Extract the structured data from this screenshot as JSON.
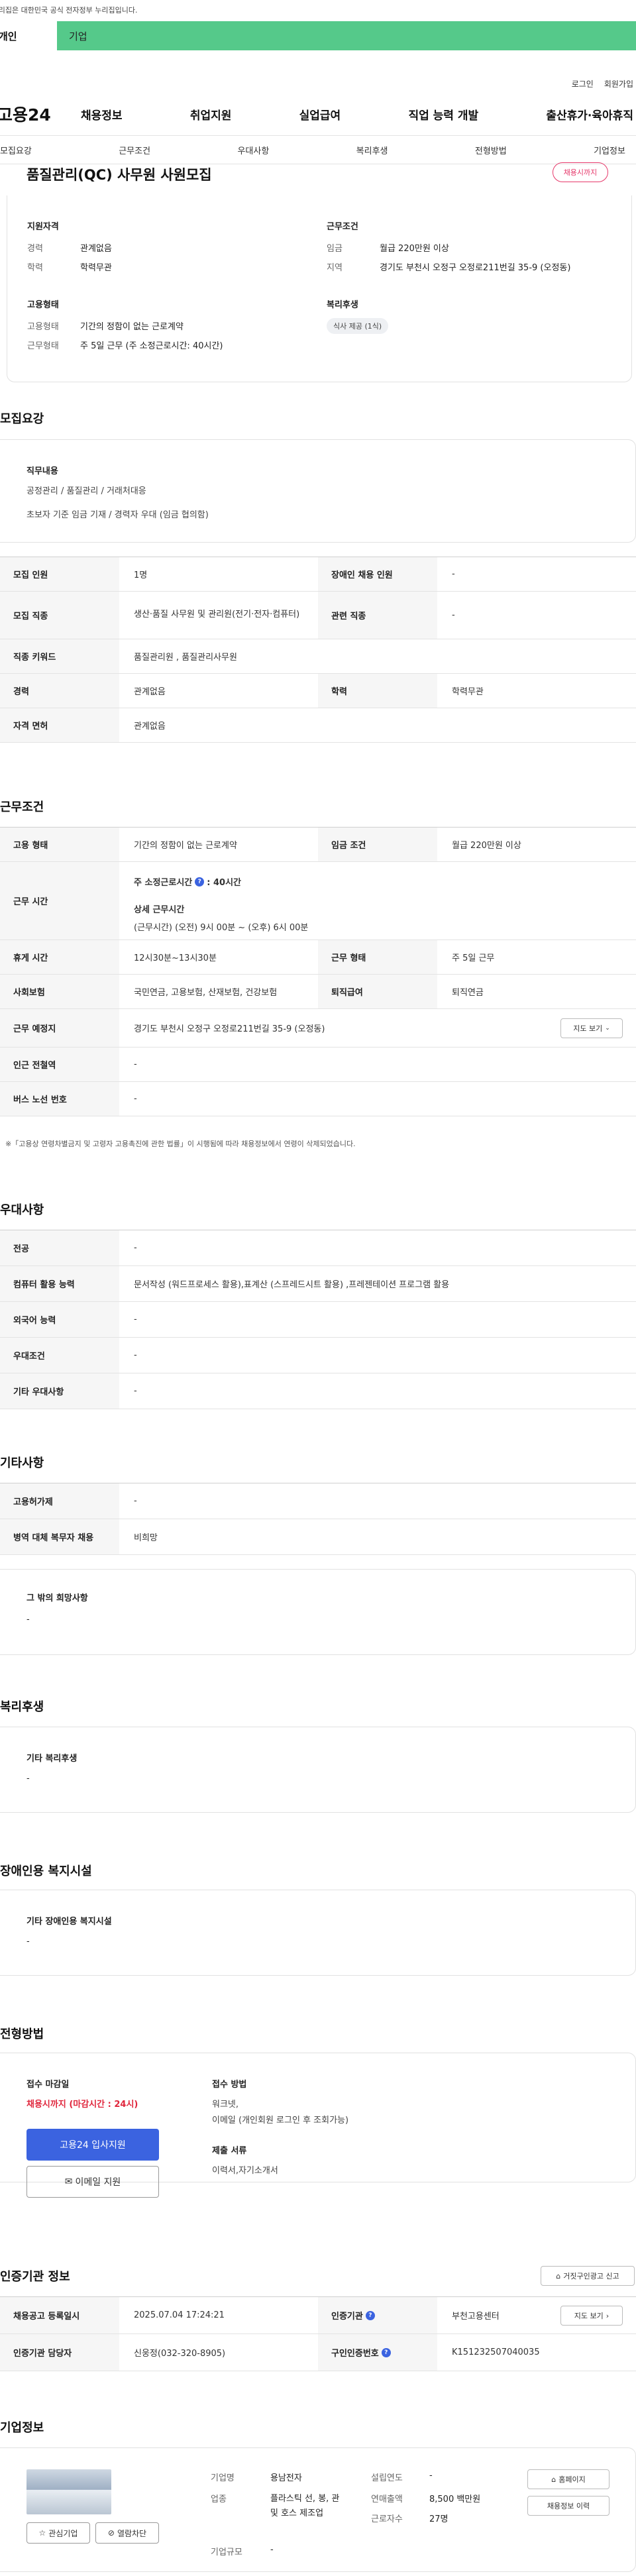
{
  "gov_banner": "이 누리집은 대한민국 공식 전자정부 누리집입니다.",
  "user_tabs": [
    "개인",
    "기업"
  ],
  "utility": [
    "로그인",
    "회원가입"
  ],
  "logo": "고용24",
  "gnb": [
    "채용정보",
    "취업지원",
    "실업급여",
    "직업 능력 개발",
    "출산휴가·육아휴직"
  ],
  "anchors": [
    "모집요강",
    "근무조건",
    "우대사항",
    "복리후생",
    "전형방법",
    "기업정보"
  ],
  "job": {
    "title": "품질관리(QC) 사무원 사원모집",
    "status": "채용시까지"
  },
  "summary": {
    "qual": {
      "title": "지원자격",
      "rows": [
        {
          "k": "경력",
          "v": "관계없음"
        },
        {
          "k": "학력",
          "v": "학력무관"
        }
      ]
    },
    "cond": {
      "title": "근무조건",
      "rows": [
        {
          "k": "임금",
          "v": "월급 220만원 이상"
        },
        {
          "k": "지역",
          "v": "경기도 부천시 오정구 오정로211번길 35-9 (오정동)"
        }
      ]
    },
    "emp": {
      "title": "고용형태",
      "rows": [
        {
          "k": "고용형태",
          "v": "기간의 정함이 없는 근로계약"
        },
        {
          "k": "근무형태",
          "v": "주 5일 근무 (주 소정근로시간: 40시간)"
        }
      ]
    },
    "welfare": {
      "title": "복리후생",
      "tag": "식사 제공 (1식)"
    }
  },
  "recruit": {
    "heading": "모집요강",
    "duty_title": "직무내용",
    "duty_lines": [
      "공정관리 / 품질관리 / 거래처대응",
      "초보자 기준 임금 기재 / 경력자 우대 (임금 협의함)"
    ],
    "t1": {
      "k1": "모집 인원",
      "v1": "1명",
      "k2": "장애인 채용 인원",
      "v2": "-"
    },
    "t2": {
      "k1": "모집 직종",
      "v1": "생산·품질 사무원 및 관리원(전기·전자·컴퓨터)",
      "k2": "관련 직종",
      "v2": "-"
    },
    "t3": {
      "k": "직종 키워드",
      "v": "품질관리원 , 품질관리사무원"
    },
    "t4": {
      "k1": "경력",
      "v1": "관계없음",
      "k2": "학력",
      "v2": "학력무관"
    },
    "t5": {
      "k": "자격 면허",
      "v": "관계없음"
    }
  },
  "work": {
    "heading": "근무조건",
    "r1": {
      "k1": "고용 형태",
      "v1": "기간의 정함이 없는 근로계약",
      "k2": "임금 조건",
      "v2": "월급 220만원 이상"
    },
    "r2": {
      "k": "근무 시간",
      "l1": "주 소정근로시간",
      "l1v": ": 40시간",
      "l2": "상세 근무시간",
      "l3": "(근무시간) (오전) 9시 00분 ~ (오후) 6시 00분"
    },
    "r3": {
      "k1": "휴게 시간",
      "v1": "12시30분~13시30분",
      "k2": "근무 형태",
      "v2": "주 5일 근무"
    },
    "r4": {
      "k1": "사회보험",
      "v1": "국민연금, 고용보험, 산재보험, 건강보험",
      "k2": "퇴직급여",
      "v2": "퇴직연금"
    },
    "r5": {
      "k": "근무 예정지",
      "v": "경기도 부천시 오정구 오정로211번길 35-9 (오정동)",
      "btn": "지도 보기"
    },
    "r6": {
      "k": "인근 전철역",
      "v": "-"
    },
    "r7": {
      "k": "버스 노선 번호",
      "v": "-"
    },
    "note": "※「고용상 연령차별금지 및 고령자 고용촉진에 관한 법률」이 시행됨에 따라 채용정보에서 연령이 삭제되었습니다."
  },
  "pref": {
    "heading": "우대사항",
    "rows": [
      {
        "k": "전공",
        "v": "-"
      },
      {
        "k": "컴퓨터 활용 능력",
        "v": "문서작성 (워드프로세스 활용),표계산 (스프레드시트 활용) ,프레젠테이션 프로그램 활용"
      },
      {
        "k": "외국어 능력",
        "v": "-"
      },
      {
        "k": "우대조건",
        "v": "-"
      },
      {
        "k": "기타 우대사항",
        "v": "-"
      }
    ]
  },
  "etc": {
    "heading": "기타사항",
    "rows": [
      {
        "k": "고용허가제",
        "v": "-"
      },
      {
        "k": "병역 대체 복무자 채용",
        "v": "비희망"
      }
    ],
    "hope_title": "그 밖의 희망사항",
    "hope_value": "-"
  },
  "benefit": {
    "heading": "복리후생",
    "title": "기타 복리후생",
    "value": "-"
  },
  "disabled": {
    "heading": "장애인용 복지시설",
    "title": "기타 장애인용 복지시설",
    "value": "-"
  },
  "apply": {
    "heading": "전형방법",
    "deadline_title": "접수 마감일",
    "deadline": "채용시까지 (마감시간 : 24시)",
    "apply_btn": "고용24 입사지원",
    "email_btn": "이메일 지원",
    "method_title": "접수 방법",
    "method_lines": [
      "워크넷,",
      "이메일 (개인회원 로그인 후 조회가능)"
    ],
    "docs_title": "제출 서류",
    "docs": "이력서,자기소개서"
  },
  "agency": {
    "heading": "인증기관 정보",
    "report_btn": "거짓구인광고 신고",
    "r1": {
      "k1": "채용공고 등록일시",
      "v1": "2025.07.04 17:24:21",
      "k2": "인증기관",
      "v2": "부천고용센터",
      "btn": "지도 보기"
    },
    "r2": {
      "k1": "인증기관 담당자",
      "v1": "신웅정(032-320-8905)",
      "k2": "구인인증번호",
      "v2": "K151232507040035"
    }
  },
  "company": {
    "heading": "기업정보",
    "fav_btn": "관심기업",
    "block_btn": "열람차단",
    "name_k": "기업명",
    "name_v": "용남전자",
    "ind_k": "업종",
    "ind_v": "플라스틱 선, 봉, 관 및 호스 제조업",
    "size_k": "기업규모",
    "size_v": "-",
    "est_k": "설립연도",
    "est_v": "-",
    "sales_k": "연매출액",
    "sales_v": "8,500 백만원",
    "emp_k": "근로자수",
    "emp_v": "27명",
    "home_btn": "홈페이지",
    "history_btn": "채용정보 이력"
  }
}
